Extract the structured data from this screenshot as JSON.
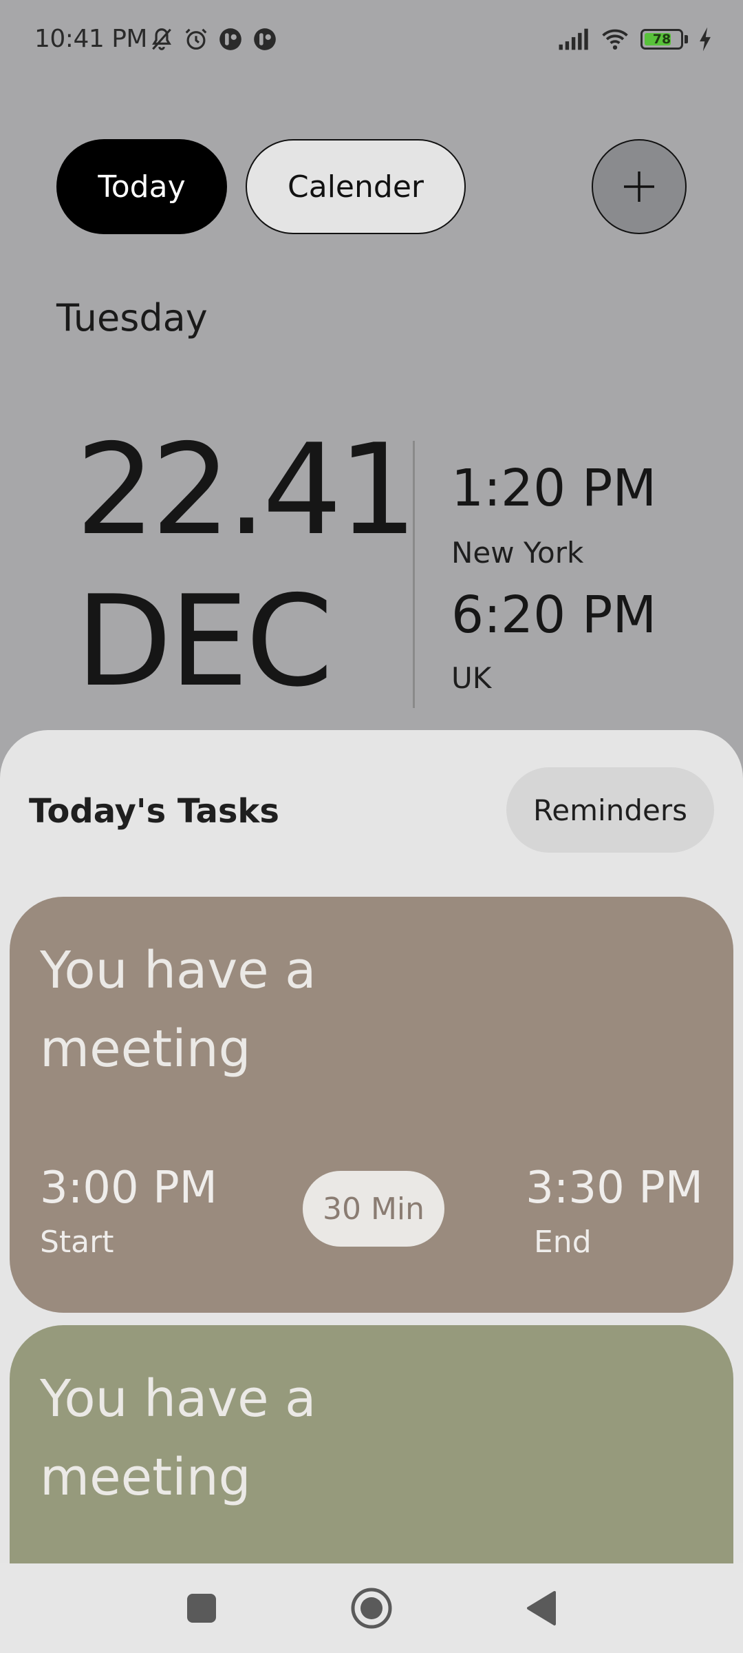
{
  "status_bar": {
    "time": "10:41 PM",
    "battery": "78",
    "battery_level": 0.78,
    "icons": [
      "bell-off-icon",
      "alarm-icon",
      "app-notification-icon",
      "app-notification-icon",
      "signal-icon",
      "wifi-icon",
      "battery-icon",
      "charging-icon"
    ]
  },
  "tabs": {
    "today": "Today",
    "calendar": "Calender"
  },
  "header": {
    "weekday": "Tuesday",
    "date": "22.41",
    "month": "DEC"
  },
  "world_clocks": [
    {
      "time": "1:20 PM",
      "city": "New York"
    },
    {
      "time": "6:20 PM",
      "city": "UK"
    }
  ],
  "tasks_section": {
    "title": "Today's Tasks",
    "reminders_label": "Reminders"
  },
  "tasks": [
    {
      "title": "You have a meeting",
      "start_time": "3:00 PM",
      "start_label": "Start",
      "duration": "30 Min",
      "end_time": "3:30 PM",
      "end_label": "End",
      "color": "#9a8b7e"
    },
    {
      "title": "You have a meeting",
      "color": "#969a7c"
    }
  ],
  "colors": {
    "background": "#a7a7a9",
    "sheet": "#e5e5e5",
    "active_tab": "#000000"
  }
}
